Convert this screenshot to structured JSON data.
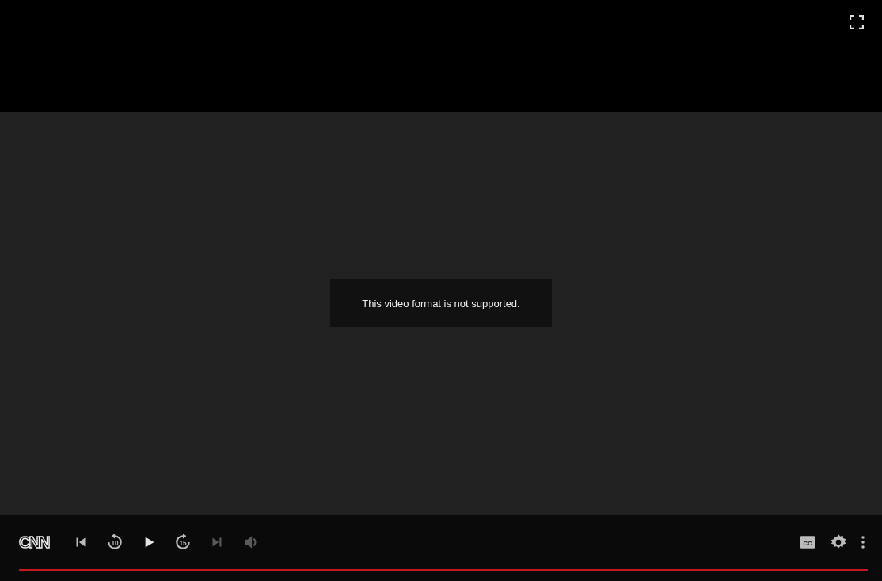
{
  "message": "This video format is not supported.",
  "logo": "CNN",
  "controls": [
    {
      "kind": "previous",
      "disabled": false
    },
    {
      "kind": "rewind",
      "label": "10",
      "disabled": false
    },
    {
      "kind": "play",
      "disabled": false
    },
    {
      "kind": "forward",
      "label": "15",
      "disabled": false
    },
    {
      "kind": "next",
      "disabled": true
    },
    {
      "kind": "volume",
      "disabled": true
    }
  ],
  "right_controls": [
    {
      "kind": "captions",
      "label": "CC",
      "disabled": false
    },
    {
      "kind": "settings",
      "disabled": false
    },
    {
      "kind": "more",
      "disabled": false
    }
  ]
}
